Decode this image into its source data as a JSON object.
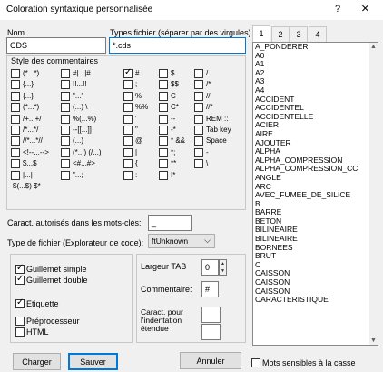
{
  "window": {
    "title": "Coloration syntaxique personnalisée",
    "help_glyph": "?",
    "close_glyph": "×"
  },
  "nom": {
    "label": "Nom",
    "value": "CDS"
  },
  "types": {
    "label": "Types fichier (séparer par des virgules)",
    "value": "*.cds"
  },
  "comments": {
    "title": "Style des commentaires",
    "col1": [
      "(*...*)",
      "{...}",
      "{...}",
      "(*...*)",
      "/+...+/",
      "/*...*/",
      "//*...*//",
      "<!--...-->",
      "$...$",
      "|...|",
      "$(...$)  $*"
    ],
    "col2": [
      "#|...|#",
      "!!...!!",
      "\"...\"",
      "(...) \\",
      "%(...%)",
      "--[[...]]",
      "(...)",
      "(*...)  (/...)",
      "<#...#>",
      "\"...;"
    ],
    "col3": [
      "#",
      ";",
      "%",
      "%%",
      "'",
      "\"",
      "@",
      "|",
      "{",
      ":"
    ],
    "col3_checked": [
      true,
      false,
      false,
      false,
      false,
      false,
      false,
      false,
      false,
      false
    ],
    "col4": [
      "$",
      "$$",
      "C",
      "C*",
      "--",
      "-*",
      "*  &&",
      "*;",
      "**",
      "!*"
    ],
    "col5": [
      "/",
      "/*",
      "//",
      "//*",
      "REM ::",
      "Tab key",
      "Space",
      "-",
      "\\"
    ]
  },
  "chars_label": "Caract. autorisés dans les mots-clés:",
  "chars_value": "_",
  "filetype": {
    "label": "Type de fichier (Explorateur de code):",
    "value": "ftUnknown",
    "arrow": "⌵"
  },
  "options": [
    {
      "label": "Guillemet simple",
      "checked": true
    },
    {
      "label": "Guillemet double",
      "checked": true
    },
    {
      "label": "Etiquette",
      "checked": true
    },
    {
      "label": "Préprocesseur",
      "checked": false
    },
    {
      "label": "HTML",
      "checked": false
    }
  ],
  "tab_width": {
    "label": "Largeur TAB",
    "value": "0"
  },
  "comment": {
    "label": "Commentaire:",
    "value": "#"
  },
  "indent": {
    "label": "Caract. pour l'indentation étendue",
    "value": ""
  },
  "tabs": [
    "1",
    "2",
    "3",
    "4"
  ],
  "keywords": [
    "A_PONDERER",
    "A0",
    "A1",
    "A2",
    "A3",
    "A4",
    "ACCIDENT",
    "ACCIDENTEL",
    "ACCIDENTELLE",
    "ACIER",
    "AIRE",
    "AJOUTER",
    "ALPHA",
    "ALPHA_COMPRESSION",
    "ALPHA_COMPRESSION_CC",
    "ANGLE",
    "ARC",
    "AVEC_FUMEE_DE_SILICE",
    "B",
    "BARRE",
    "BETON",
    "BILINEAIRE",
    "BILINEAIRE",
    "BORNEES",
    "BRUT",
    "C",
    "CAISSON",
    "CAISSON",
    "CAISSON",
    "CARACTERISTIQUE"
  ],
  "buttons": {
    "load": "Charger",
    "save": "Sauver",
    "cancel": "Annuler"
  },
  "case_sensitive": {
    "label": "Mots sensibles à la casse",
    "checked": false
  },
  "icons": {
    "scroll_up": "▲",
    "scroll_down": "▼",
    "spin_up": "▲",
    "spin_down": "▼"
  }
}
